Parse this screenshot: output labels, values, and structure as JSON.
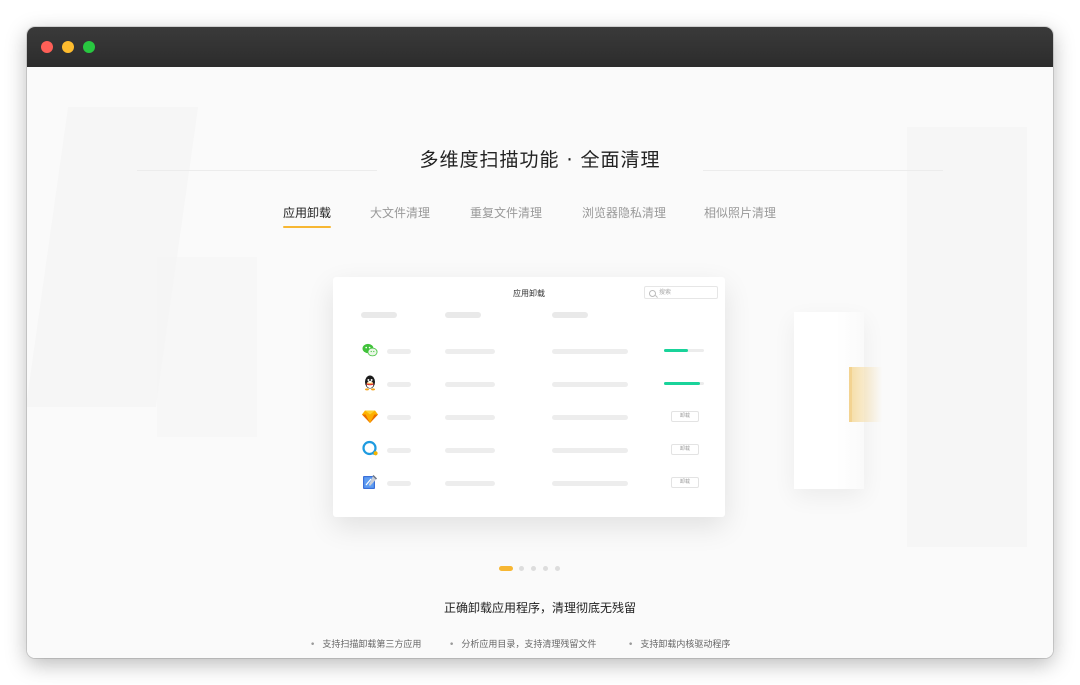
{
  "window": {
    "controls": [
      "close",
      "minimize",
      "zoom"
    ]
  },
  "hero": {
    "title": "多维度扫描功能 · 全面清理"
  },
  "tabs": [
    {
      "label": "应用卸载",
      "active": true
    },
    {
      "label": "大文件清理",
      "active": false
    },
    {
      "label": "重复文件清理",
      "active": false
    },
    {
      "label": "浏览器隐私清理",
      "active": false
    },
    {
      "label": "相似照片清理",
      "active": false
    }
  ],
  "preview": {
    "title": "应用卸载",
    "search_placeholder": "搜索",
    "rows": [
      {
        "icon": "wechat-icon",
        "action": "progress",
        "progress": 0.6
      },
      {
        "icon": "qq-icon",
        "action": "progress",
        "progress": 0.9
      },
      {
        "icon": "sketch-icon",
        "action": "button",
        "button_label": "卸载"
      },
      {
        "icon": "chat-bubble-icon",
        "action": "button",
        "button_label": "卸载"
      },
      {
        "icon": "xcode-icon",
        "action": "button",
        "button_label": "卸载"
      }
    ]
  },
  "carousel": {
    "count": 5,
    "active_index": 0
  },
  "description": {
    "subtitle": "正确卸载应用程序，清理彻底无残留",
    "features": [
      "支持扫描卸载第三方应用",
      "分析应用目录，支持清理残留文件",
      "支持卸载内核驱动程序"
    ]
  },
  "colors": {
    "accent": "#f7b733",
    "progress": "#19d39a",
    "titlebar": "#2f2f2f"
  }
}
